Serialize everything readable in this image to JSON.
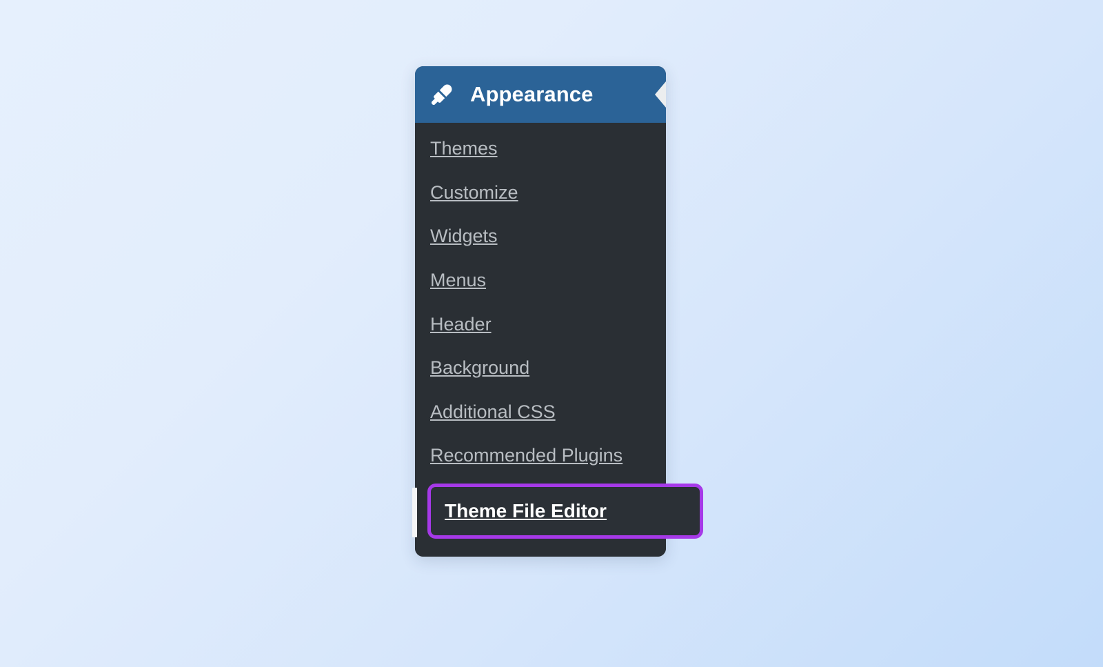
{
  "background": {
    "gradient_from": "#e6f0fd",
    "gradient_to": "#c3dcfa"
  },
  "flyout": {
    "header": {
      "title": "Appearance",
      "icon": "paintbrush-icon",
      "arrow": "left-pointer-arrow",
      "background_color": "#2b6397",
      "text_color": "#ffffff"
    },
    "panel": {
      "background_color": "#2a2f34",
      "item_color": "#b8bdc2"
    },
    "items": [
      {
        "label": "Themes",
        "current": false
      },
      {
        "label": "Customize",
        "current": false
      },
      {
        "label": "Widgets",
        "current": false
      },
      {
        "label": "Menus",
        "current": false
      },
      {
        "label": "Header",
        "current": false
      },
      {
        "label": "Background",
        "current": false
      },
      {
        "label": "Additional CSS",
        "current": false
      },
      {
        "label": "Recommended Plugins",
        "current": false
      },
      {
        "label": "Theme File Editor",
        "current": true
      }
    ],
    "highlight": {
      "label": "Theme File Editor",
      "border_color": "#a639e8",
      "text_color": "#ffffff"
    }
  }
}
